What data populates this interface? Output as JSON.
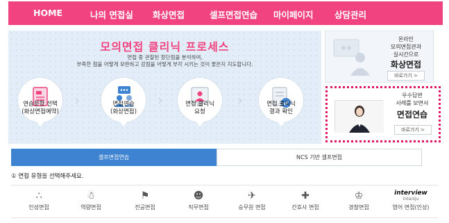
{
  "nav": {
    "items": [
      "HOME",
      "나의 면접실",
      "화상면접",
      "셀프면접연습",
      "마이페이지",
      "상담관리"
    ]
  },
  "banner": {
    "title": "모의면접 클리닉 프로세스",
    "subtitle_line1": "면접 중 관찰된 장단점을 분석하여,",
    "subtitle_line2": "부족한 점을 어떻게 보완하고 강점을 어떻게 부각 시키는 것이 좋은지 지도합니다.",
    "steps": [
      {
        "line1": "연습문항 선택",
        "line2": "(화상면접예약)",
        "icon": "document-icon"
      },
      {
        "line1": "면접연습",
        "line2": "(화상면접)",
        "icon": "people-chat-icon"
      },
      {
        "line1": "면접 클리닉",
        "line2": "요청",
        "icon": "person-screen-icon"
      },
      {
        "line1": "면접 클리닉",
        "line2": "결과 확인",
        "icon": "checked-document-icon"
      }
    ]
  },
  "promo_online": {
    "line1": "온라인",
    "line2": "모의면접관과",
    "line3": "실시간으로",
    "highlight": "화상면접",
    "button": "바로가기 >"
  },
  "promo_practice": {
    "line1": "우수답변",
    "line2": "사례를 보면서",
    "highlight": "면접연습",
    "button": "바로가기 >"
  },
  "tabs": {
    "active": "셀프면접연습",
    "inactive": "NCS 기반 셀프면접"
  },
  "instruction": "① 면접 유형을 선택해주세요.",
  "categories": [
    {
      "label": "인성면접",
      "icon": "group-icon"
    },
    {
      "label": "역량면접",
      "icon": "team-icon"
    },
    {
      "label": "전공면접",
      "icon": "presenter-icon"
    },
    {
      "label": "직무면접",
      "icon": "worker-icon"
    },
    {
      "label": "승무원 면접",
      "icon": "airplane-icon"
    },
    {
      "label": "간호사 면접",
      "icon": "medical-kit-icon"
    },
    {
      "label": "경찰면접",
      "icon": "police-icon"
    },
    {
      "label": "영어 면접(인성)",
      "icon": "interview-logo",
      "logo_text": "interview",
      "logo_sub": "Intaniju"
    }
  ],
  "colors": {
    "nav_bg": "#f0437f",
    "title_pink": "#f0437f",
    "tab_blue": "#3d83d1",
    "promo_dotted_border": "#e01563",
    "banner_bg": "#e3edf7"
  }
}
